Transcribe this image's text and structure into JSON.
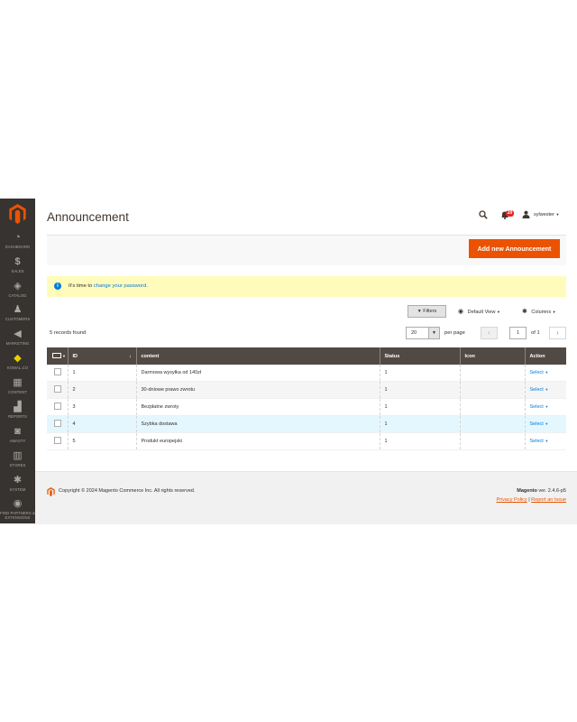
{
  "colors": {
    "accent": "#eb5202",
    "sidebar": "#373330",
    "grid_header": "#514943",
    "link": "#007bdb",
    "message_bg": "#fffbbb"
  },
  "sidebar": {
    "items": [
      {
        "label": "DASHBOARD",
        "icon": "speedometer-icon"
      },
      {
        "label": "SALES",
        "icon": "dollar-icon"
      },
      {
        "label": "CATALOG",
        "icon": "cube-icon"
      },
      {
        "label": "CUSTOMERS",
        "icon": "person-icon"
      },
      {
        "label": "MARKETING",
        "icon": "megaphone-icon"
      },
      {
        "label": "KOWAL.CO",
        "icon": "diamond-icon"
      },
      {
        "label": "CONTENT",
        "icon": "layout-icon"
      },
      {
        "label": "REPORTS",
        "icon": "bar-chart-icon"
      },
      {
        "label": "AMASTY",
        "icon": "amasty-icon"
      },
      {
        "label": "STORES",
        "icon": "storefront-icon"
      },
      {
        "label": "SYSTEM",
        "icon": "gear-icon"
      },
      {
        "label": "FIND PARTNERS & EXTENSIONS",
        "icon": "box-icon"
      }
    ]
  },
  "header": {
    "title": "Announcement",
    "notification_count": "20",
    "user": "sylwester"
  },
  "actions": {
    "add_button": "Add new Announcement"
  },
  "message": {
    "text_before": "It's time to ",
    "link": "change your password",
    "text_after": "."
  },
  "toolbar": {
    "filters": "Filters",
    "view": "Default View",
    "columns": "Columns",
    "records_found": "5 records found",
    "per_page_value": "20",
    "per_page_label": "per page",
    "page": "1",
    "of_label": "of 1"
  },
  "grid": {
    "columns": [
      "ID",
      "content",
      "Status",
      "Icon",
      "Action"
    ],
    "rows": [
      {
        "id": "1",
        "content": "Darmowa wysyłka od 140zł",
        "status": "1",
        "icon": "",
        "action": "Select"
      },
      {
        "id": "2",
        "content": "30-dniowe prawo zwrotu",
        "status": "1",
        "icon": "",
        "action": "Select"
      },
      {
        "id": "3",
        "content": "Bezpłatne zwroty",
        "status": "1",
        "icon": "",
        "action": "Select"
      },
      {
        "id": "4",
        "content": "Szybka dostawa",
        "status": "1",
        "icon": "",
        "action": "Select"
      },
      {
        "id": "5",
        "content": "Produkt europejski",
        "status": "1",
        "icon": "",
        "action": "Select"
      }
    ]
  },
  "footer": {
    "copyright": "Copyright © 2024 Magento Commerce Inc. All rights reserved.",
    "brand": "Magento",
    "version": " ver. 2.4.6-p5",
    "privacy": "Privacy Policy",
    "separator": "|",
    "report": "Report an Issue"
  }
}
